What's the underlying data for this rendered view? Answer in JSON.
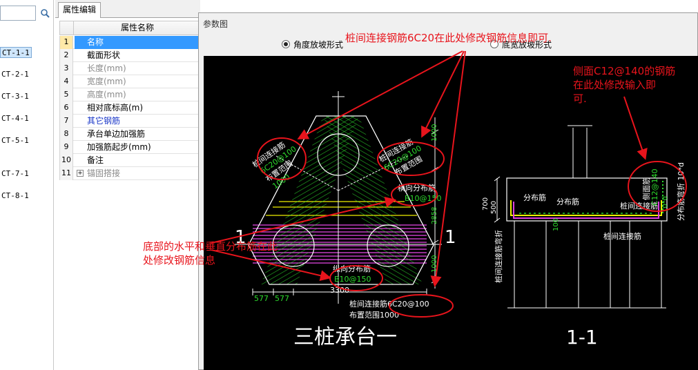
{
  "tree": {
    "items": [
      "CT-1-1",
      "CT-2-1",
      "CT-3-1",
      "CT-4-1",
      "CT-5-1",
      "CT-7-1",
      "CT-8-1"
    ],
    "selected_index": 0
  },
  "panel": {
    "tab_label": "属性编辑",
    "header": "属性名称",
    "rows": [
      {
        "num": "1",
        "label": "名称"
      },
      {
        "num": "2",
        "label": "截面形状"
      },
      {
        "num": "3",
        "label": "长度(mm)"
      },
      {
        "num": "4",
        "label": "宽度(mm)"
      },
      {
        "num": "5",
        "label": "高度(mm)"
      },
      {
        "num": "6",
        "label": "相对底标高(m)"
      },
      {
        "num": "7",
        "label": "其它钢筋"
      },
      {
        "num": "8",
        "label": "承台单边加强筋"
      },
      {
        "num": "9",
        "label": "加强筋起步(mm)"
      },
      {
        "num": "10",
        "label": "备注"
      },
      {
        "num": "11",
        "label": "锚固搭接"
      }
    ]
  },
  "dialog": {
    "title": "参数图",
    "radio1": "角度放坡形式",
    "radio2": "底宽放坡形式"
  },
  "drawing": {
    "plan_title": "三桩承台一",
    "section_title": "1-1",
    "section_mark": "1",
    "label_pile_conn_left_1": "桩间连接筋",
    "label_pile_conn_left_2": "6C20@100",
    "label_range_left": "布置范围",
    "label_1000_left": "1000",
    "label_pile_conn_right_1": "桩间连接筋",
    "label_pile_conn_right_2": "6C20@100",
    "label_range_right": "布置范围",
    "label_dim_1000a": "1000",
    "label_trans_dist_1": "横向分布筋",
    "label_trans_dist_2": "B10@150",
    "label_dim_2858": "2858",
    "label_dim_1000b": "1000",
    "label_long_dist_1": "纵向分布筋",
    "label_long_dist_2": "B10@150",
    "label_dim_3300": "3300",
    "label_dim_577a": "577",
    "label_dim_577b": "577",
    "label_bottom_conn": "桩间连接筋6C20@100",
    "label_bottom_range": "布置范围1000",
    "sec_dist_a": "分布筋",
    "sec_dist_b": "分布筋",
    "sec_pile_conn": "桩间连接筋",
    "sec_side_1": "侧面筋",
    "sec_side_2": "C12@140",
    "sec_700": "700",
    "sec_500": "500",
    "sec_100": "100",
    "sec_pile_conn_lower": "桩间连接筋",
    "sec_bend_left": "桩间连接筋弯折",
    "sec_bend_right": "分布筋弯折 10*d",
    "sec_10d": "10*d"
  },
  "annotations": {
    "top": "桩间连接钢筋6C20在此处修改钢筋信息即可.",
    "right_1": "侧面C12@140的钢筋",
    "right_2": "在此处修改输入即",
    "right_3": "可.",
    "bottom_1": "底部的水平和垂直分布筋在此",
    "bottom_2": "处修改钢筋信息"
  },
  "colors": {
    "accent_selection": "#3399ff",
    "annotation_red": "#e8141c",
    "rebar_green": "#2ddb2d",
    "rebar_yellow": "#f0f000",
    "rebar_magenta": "#e040e0"
  }
}
